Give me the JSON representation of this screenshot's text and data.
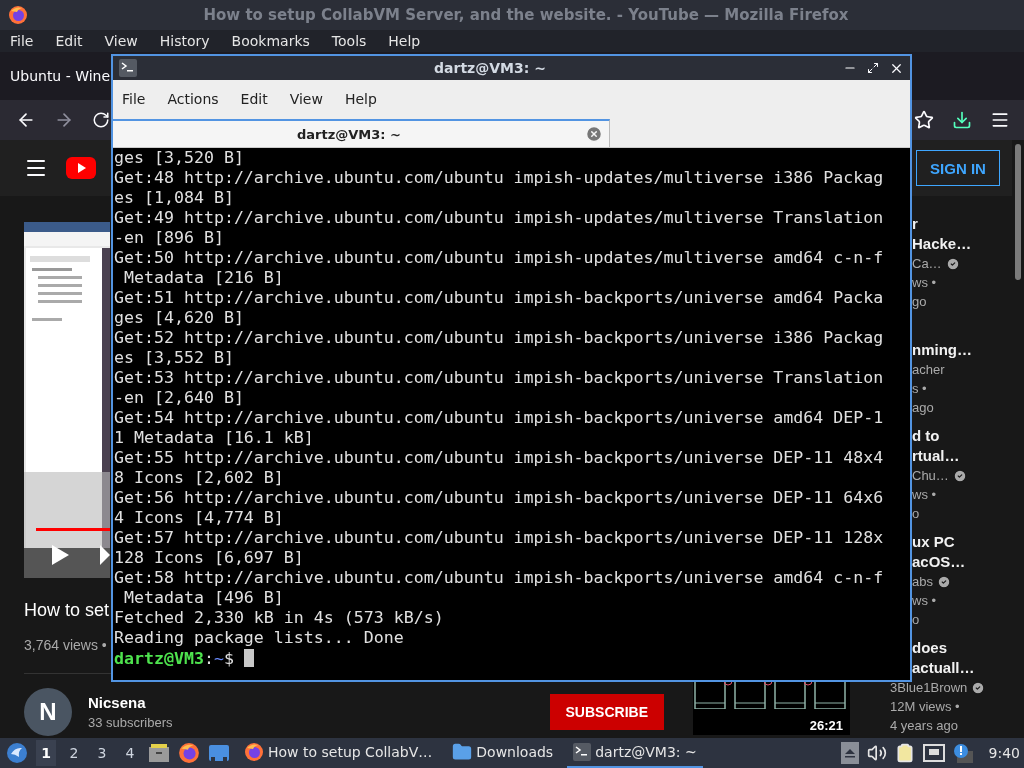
{
  "firefox": {
    "title": "How to setup CollabVM Server, and the website. - YouTube — Mozilla Firefox",
    "menu": [
      "File",
      "Edit",
      "View",
      "History",
      "Bookmarks",
      "Tools",
      "Help"
    ],
    "tab": "Ubuntu - Wine"
  },
  "youtube": {
    "sign_in": "SIGN IN",
    "player": {
      "level": 1
    },
    "video": {
      "title": "How to set",
      "views": "3,764 views •"
    },
    "channel": {
      "avatar_letter": "N",
      "name": "Nicsena",
      "subscribers": "33 subscribers",
      "subscribe": "SUBSCRIBE"
    },
    "recommendations": [
      {
        "title": [
          "r",
          "Hacke…"
        ],
        "channel": "Ca…",
        "verified": true,
        "views": "ws •",
        "age": "go"
      },
      {
        "title": [
          "nming…"
        ],
        "channel": "acher",
        "verified": false,
        "views": "s •",
        "age": "ago"
      },
      {
        "title": [
          "d to",
          "rtual…"
        ],
        "channel": "Chu…",
        "verified": true,
        "views": "ws •",
        "age": "o"
      },
      {
        "title": [
          "ux PC",
          "acOS…"
        ],
        "channel": "abs",
        "verified": true,
        "views": "ws •",
        "age": "o"
      },
      {
        "title": [
          "does",
          "actuall…"
        ],
        "channel": "3Blue1Brown",
        "verified": true,
        "views": "12M views •",
        "age": "4 years ago",
        "duration": "26:21"
      }
    ]
  },
  "terminal": {
    "title": "dartz@VM3: ~",
    "menu": [
      "File",
      "Actions",
      "Edit",
      "View",
      "Help"
    ],
    "tab": "dartz@VM3: ~",
    "lines": [
      "ges [3,520 B]",
      "Get:48 http://archive.ubuntu.com/ubuntu impish-updates/multiverse i386 Packag",
      "es [1,084 B]",
      "Get:49 http://archive.ubuntu.com/ubuntu impish-updates/multiverse Translation",
      "-en [896 B]",
      "Get:50 http://archive.ubuntu.com/ubuntu impish-updates/multiverse amd64 c-n-f",
      " Metadata [216 B]",
      "Get:51 http://archive.ubuntu.com/ubuntu impish-backports/universe amd64 Packa",
      "ges [4,620 B]",
      "Get:52 http://archive.ubuntu.com/ubuntu impish-backports/universe i386 Packag",
      "es [3,552 B]",
      "Get:53 http://archive.ubuntu.com/ubuntu impish-backports/universe Translation",
      "-en [2,640 B]",
      "Get:54 http://archive.ubuntu.com/ubuntu impish-backports/universe amd64 DEP-1",
      "1 Metadata [16.1 kB]",
      "Get:55 http://archive.ubuntu.com/ubuntu impish-backports/universe DEP-11 48x4",
      "8 Icons [2,602 B]",
      "Get:56 http://archive.ubuntu.com/ubuntu impish-backports/universe DEP-11 64x6",
      "4 Icons [4,774 B]",
      "Get:57 http://archive.ubuntu.com/ubuntu impish-backports/universe DEP-11 128x",
      "128 Icons [6,697 B]",
      "Get:58 http://archive.ubuntu.com/ubuntu impish-backports/universe amd64 c-n-f",
      " Metadata [496 B]",
      "Fetched 2,330 kB in 4s (573 kB/s)",
      "Reading package lists... Done"
    ],
    "prompt": {
      "user_host": "dartz@VM3",
      "separator": ":",
      "path": "~",
      "symbol": "$"
    }
  },
  "taskbar": {
    "workspaces": [
      {
        "label": "1",
        "selected": true
      },
      {
        "label": "2",
        "selected": false
      },
      {
        "label": "3",
        "selected": false
      },
      {
        "label": "4",
        "selected": false
      }
    ],
    "tasks": [
      {
        "kind": "firefox",
        "label": "How to setup CollabV…",
        "selected": false
      },
      {
        "kind": "folder",
        "label": "Downloads",
        "selected": false
      },
      {
        "kind": "terminal",
        "label": "dartz@VM3: ~",
        "selected": true
      }
    ],
    "clock": "9:40"
  }
}
